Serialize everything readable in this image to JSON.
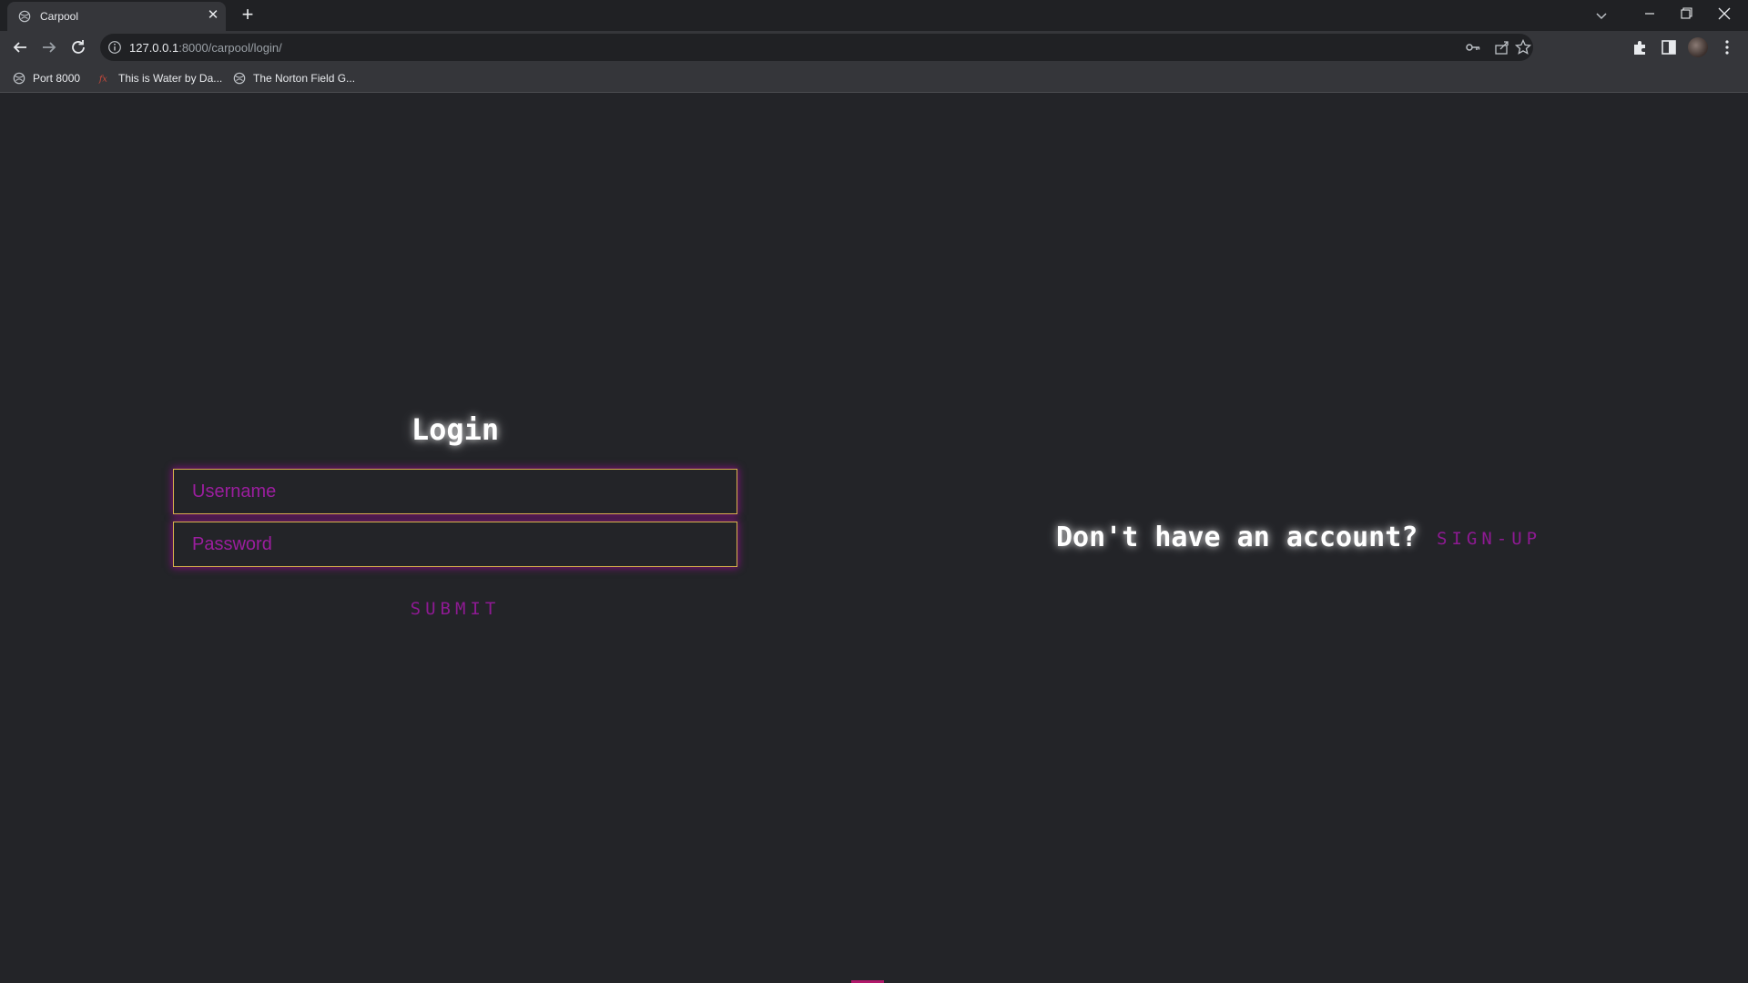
{
  "browser": {
    "tab": {
      "title": "Carpool",
      "close_glyph": "✕"
    },
    "new_tab_glyph": "+",
    "address": {
      "host": "127.0.0.1",
      "rest": ":8000/carpool/login/"
    },
    "bookmarks": [
      {
        "label": "Port 8000",
        "icon": "globe-icon"
      },
      {
        "label": "This is Water by Da...",
        "icon": "fx-icon"
      },
      {
        "label": "The Norton Field G...",
        "icon": "globe-icon"
      }
    ]
  },
  "login": {
    "title": "Login",
    "username_placeholder": "Username",
    "password_placeholder": "Password",
    "submit_label": "SUBMIT"
  },
  "signup": {
    "prompt": "Don't have an account?",
    "link_label": "SIGN-UP"
  },
  "colors": {
    "background": "#232428",
    "accent_magenta": "#8e1a93",
    "field_border": "#d9b24c",
    "glow": "#c800be"
  }
}
